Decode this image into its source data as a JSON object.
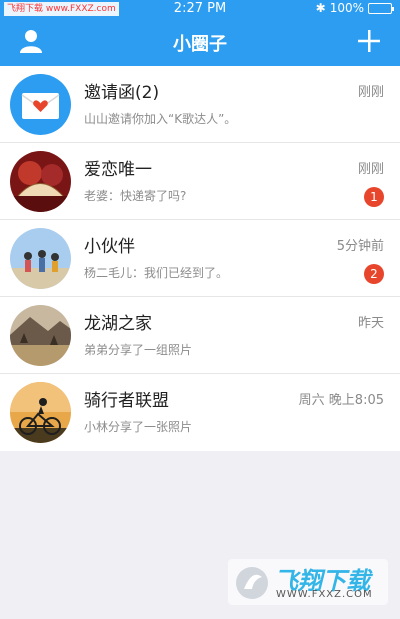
{
  "status": {
    "site": "飞翔下载 www.FXXZ.com",
    "time": "2:27 PM",
    "battery": "100%",
    "battery_level": 1.0
  },
  "nav": {
    "title": "小圈子",
    "profile_icon": "person-icon",
    "add_icon": "plus-icon"
  },
  "items": [
    {
      "name": "邀请函(2)",
      "time": "刚刚",
      "message": "山山邀请你加入“K歌达人”。",
      "badge": ""
    },
    {
      "name": "爱恋唯一",
      "time": "刚刚",
      "message": "老婆：快递寄了吗?",
      "badge": "1"
    },
    {
      "name": "小伙伴",
      "time": "5分钟前",
      "message": "杨二毛儿：我们已经到了。",
      "badge": "2"
    },
    {
      "name": "龙湖之家",
      "time": "昨天",
      "message": "弟弟分享了一组照片",
      "badge": ""
    },
    {
      "name": "骑行者联盟",
      "time": "周六 晚上8:05",
      "message": "小林分享了一张照片",
      "badge": ""
    }
  ],
  "watermark": {
    "text": "飞翔下载",
    "sub": "WWW.FXXZ.COM"
  }
}
